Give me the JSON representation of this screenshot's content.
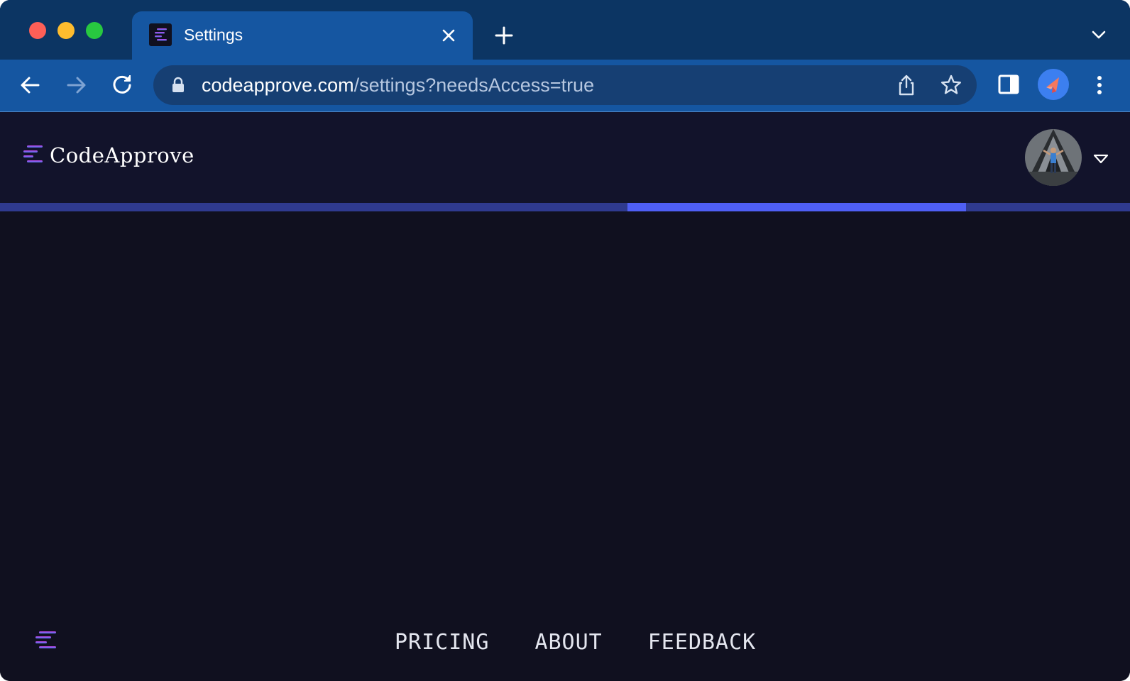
{
  "browser": {
    "tab": {
      "title": "Settings",
      "favicon": "codeapprove-logo-icon"
    },
    "omnibox": {
      "url_host": "codeapprove.com",
      "url_path": "/settings?needsAccess=true"
    },
    "icons": {
      "back": "arrow-left-icon",
      "forward": "arrow-right-icon",
      "reload": "reload-icon",
      "lock": "lock-icon",
      "share": "share-icon",
      "bookmark": "star-icon",
      "sidepanel": "side-panel-icon",
      "profile": "profile-icon",
      "menu": "kebab-menu-icon",
      "new_tab": "plus-icon",
      "tab_search": "chevron-down-icon",
      "close_tab": "close-icon"
    },
    "colors": {
      "tabstrip": "#0c3563",
      "toolbar": "#1556a1",
      "omnibox": "#163f73"
    }
  },
  "page": {
    "brand": {
      "name": "CodeApprove"
    },
    "progress": {
      "start_fraction": 0.555,
      "end_fraction": 0.855
    },
    "footer": {
      "links": [
        "PRICING",
        "ABOUT",
        "FEEDBACK"
      ]
    },
    "colors": {
      "background": "#10101f",
      "header": "#12132b",
      "progress_track": "#2f3a8f",
      "progress_fill": "#4f5ff5",
      "logo_gradient_start": "#c43ee0",
      "logo_gradient_end": "#4d7cf5"
    }
  }
}
